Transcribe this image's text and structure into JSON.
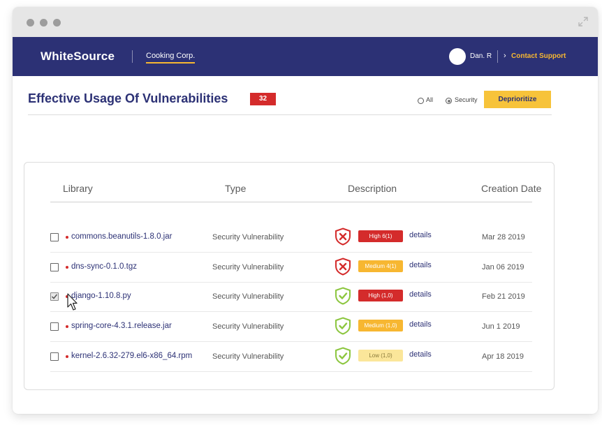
{
  "app": {
    "brand": "WhiteSource",
    "org": "Cooking Corp.",
    "user": "Dan. R",
    "contact": "Contact Support"
  },
  "page": {
    "title": "Effective Usage Of Vulnerabilities",
    "count": "32"
  },
  "filters": {
    "all_label": "All",
    "security_label": "Security",
    "selected": "Security"
  },
  "actions": {
    "deprioritize_label": "Deprioritize"
  },
  "table": {
    "headers": {
      "library": "Library",
      "type": "Type",
      "description": "Description",
      "date": "Creation Date"
    },
    "rows": [
      {
        "library": "commons.beanutils-1.8.0.jar",
        "type": "Security Vulnerability",
        "severity": "High 6(1)",
        "level": "high",
        "status": "vulnerable",
        "details": "details",
        "date": "Mar 28 2019",
        "checked": false
      },
      {
        "library": "dns-sync-0.1.0.tgz",
        "type": "Security Vulnerability",
        "severity": "Medium 4(1)",
        "level": "medium",
        "status": "vulnerable",
        "details": "details",
        "date": "Jan 06 2019",
        "checked": false
      },
      {
        "library": "django-1.10.8.py",
        "type": "Security Vulnerability",
        "severity": "High (1,0)",
        "level": "high",
        "status": "safe",
        "details": "details",
        "date": "Feb 21 2019",
        "checked": true
      },
      {
        "library": "spring-core-4.3.1.release.jar",
        "type": "Security Vulnerability",
        "severity": "Medium (1,0)",
        "level": "medium",
        "status": "safe",
        "details": "details",
        "date": "Jun 1 2019",
        "checked": false
      },
      {
        "library": "kernel-2.6.32-279.el6-x86_64.rpm",
        "type": "Security Vulnerability",
        "severity": "Low (1,0)",
        "level": "low",
        "status": "safe",
        "details": "details",
        "date": "Apr 18 2019",
        "checked": false
      }
    ]
  },
  "colors": {
    "navy": "#2c3175",
    "accent": "#f7b731",
    "danger": "#d42b2b",
    "safe": "#8cc63f"
  }
}
